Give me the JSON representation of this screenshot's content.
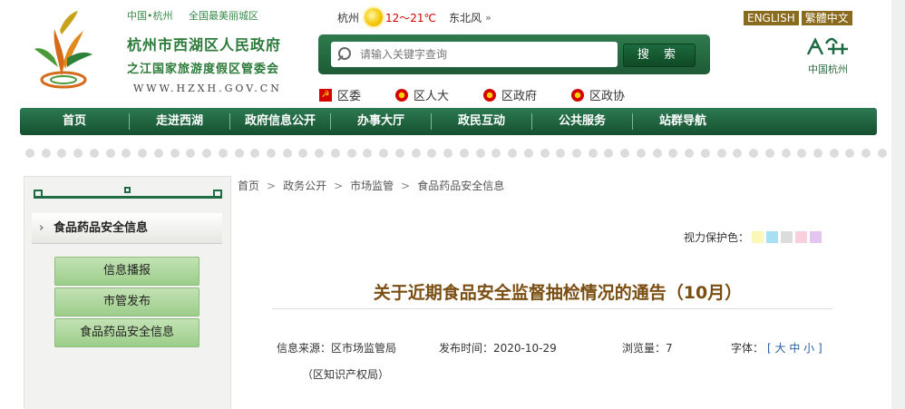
{
  "header": {
    "top_links": [
      "中国•杭州",
      "全国最美丽城区"
    ],
    "title_line1": "杭州市西湖区人民政府",
    "title_line2": "之江国家旅游度假区管委会",
    "url": "WWW.HZXH.GOV.CN",
    "weather": {
      "city": "杭州",
      "temp": "12～21℃",
      "wind": "东北风",
      "more": "»"
    },
    "search": {
      "placeholder": "请输入关键字查询",
      "button": "搜 索"
    },
    "sublinks": [
      "区委",
      "区人大",
      "区政府",
      "区政协"
    ],
    "lang": [
      "ENGLISH",
      "繁體中文"
    ],
    "city_logo_caption": "中国杭州"
  },
  "nav": {
    "items": [
      "首页",
      "走进西湖",
      "政府信息公开",
      "办事大厅",
      "政民互动",
      "公共服务",
      "站群导航"
    ]
  },
  "sidebar": {
    "title": "食品药品安全信息",
    "buttons": [
      "信息播报",
      "市管发布",
      "食品药品安全信息"
    ]
  },
  "breadcrumb": [
    "首页",
    "政务公开",
    "市场监管",
    "食品药品安全信息"
  ],
  "eye_care": {
    "label": "视力保护色：",
    "colors": [
      "#fbf7b6",
      "#a9dff3",
      "#dcdcdc",
      "#fbd0de",
      "#e3c6f0"
    ]
  },
  "article": {
    "title": "关于近期食品安全监督抽检情况的通告（10月）",
    "source": "信息来源：区市场监管局",
    "source_line2": "（区知识产权局）",
    "date": "发布时间：2020-10-29",
    "views": "浏览量：7",
    "font_label": "字体：",
    "font_sizes": "[ 大 中 小 ]"
  },
  "colors": {
    "nav_green": "#1f6b43",
    "title_brown": "#7a4e12",
    "lang_bg": "#8a6a1c",
    "sidebar_button": "#b3d9a3"
  }
}
